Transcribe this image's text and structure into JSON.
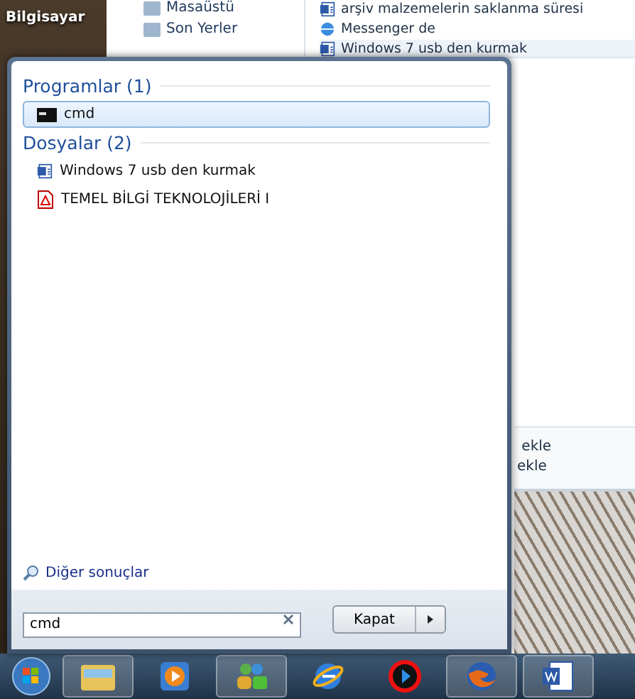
{
  "desktop": {
    "icon_label": "Bilgisayar"
  },
  "behind_window": {
    "left_items": [
      {
        "label": "Masaüstü"
      },
      {
        "label": "Son Yerler"
      }
    ],
    "right_items": [
      {
        "label": "arşiv malzemelerin saklanma süresi",
        "kind": "doc",
        "selected": false
      },
      {
        "label": "Messenger de",
        "kind": "web",
        "selected": false
      },
      {
        "label": "Windows 7 usb den kurmak",
        "kind": "doc",
        "selected": true
      }
    ],
    "lower_items": [
      " ekle",
      "ekle"
    ]
  },
  "start_menu": {
    "groups": [
      {
        "title": "Programlar (1)",
        "items": [
          {
            "label": "cmd",
            "kind": "console",
            "selected": true
          }
        ]
      },
      {
        "title": "Dosyalar (2)",
        "items": [
          {
            "label": "Windows 7 usb den kurmak",
            "kind": "doc",
            "selected": false
          },
          {
            "label": "TEMEL BİLGİ TEKNOLOJİLERİ I",
            "kind": "pdf",
            "selected": false
          }
        ]
      }
    ],
    "more_results": "Diğer sonuçlar",
    "search": {
      "value": "cmd"
    },
    "shutdown": {
      "label": "Kapat"
    }
  },
  "taskbar": [
    {
      "kind": "explorer",
      "running": true
    },
    {
      "kind": "player",
      "running": false
    },
    {
      "kind": "messenger",
      "running": true
    },
    {
      "kind": "ie",
      "running": false
    },
    {
      "kind": "quicktime",
      "running": false
    },
    {
      "kind": "firefox",
      "running": true
    },
    {
      "kind": "word",
      "running": true
    }
  ]
}
